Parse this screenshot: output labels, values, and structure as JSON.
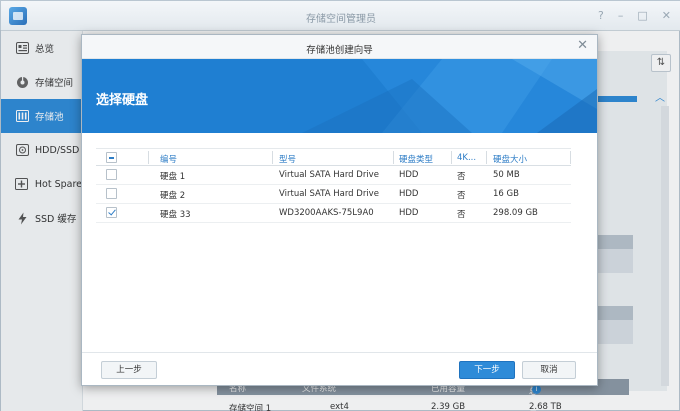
{
  "app": {
    "title": "存储空间管理员",
    "window_controls": [
      "?",
      "–",
      "□",
      "✕"
    ]
  },
  "sidebar": {
    "items": [
      {
        "label": "总览",
        "icon": "overview-icon",
        "active": false
      },
      {
        "label": "存储空间",
        "icon": "storage-volume-icon",
        "active": false
      },
      {
        "label": "存储池",
        "icon": "storage-pool-icon",
        "active": true
      },
      {
        "label": "HDD/SSD",
        "icon": "hdd-icon",
        "active": false
      },
      {
        "label": "Hot Spare",
        "icon": "hot-spare-icon",
        "active": false
      },
      {
        "label": "SSD 缓存",
        "icon": "ssd-cache-icon",
        "active": false
      }
    ]
  },
  "background": {
    "table_headers": [
      "名称",
      "文件系统",
      "已用容量",
      "总容量"
    ],
    "table_row": [
      "存储空间 1",
      "ext4",
      "2.39 GB",
      "2.68 TB"
    ]
  },
  "dialog": {
    "title": "存储池创建向导",
    "step_title": "选择硬盘",
    "table": {
      "columns": [
        "编号",
        "型号",
        "硬盘类型",
        "4K...",
        "硬盘大小"
      ],
      "rows": [
        {
          "checked": false,
          "number": "硬盘 1",
          "model": "Virtual SATA Hard Drive",
          "type": "HDD",
          "4k": "否",
          "size": "50 MB"
        },
        {
          "checked": false,
          "number": "硬盘 2",
          "model": "Virtual SATA Hard Drive",
          "type": "HDD",
          "4k": "否",
          "size": "16 GB"
        },
        {
          "checked": true,
          "number": "硬盘 33",
          "model": "WD3200AAKS-75L9A0",
          "type": "HDD",
          "4k": "否",
          "size": "298.09 GB"
        }
      ]
    },
    "buttons": {
      "prev": "上一步",
      "next": "下一步",
      "cancel": "取消"
    },
    "colors": {
      "banner": "#1f7fd2",
      "accent": "#2e8bd8"
    }
  }
}
